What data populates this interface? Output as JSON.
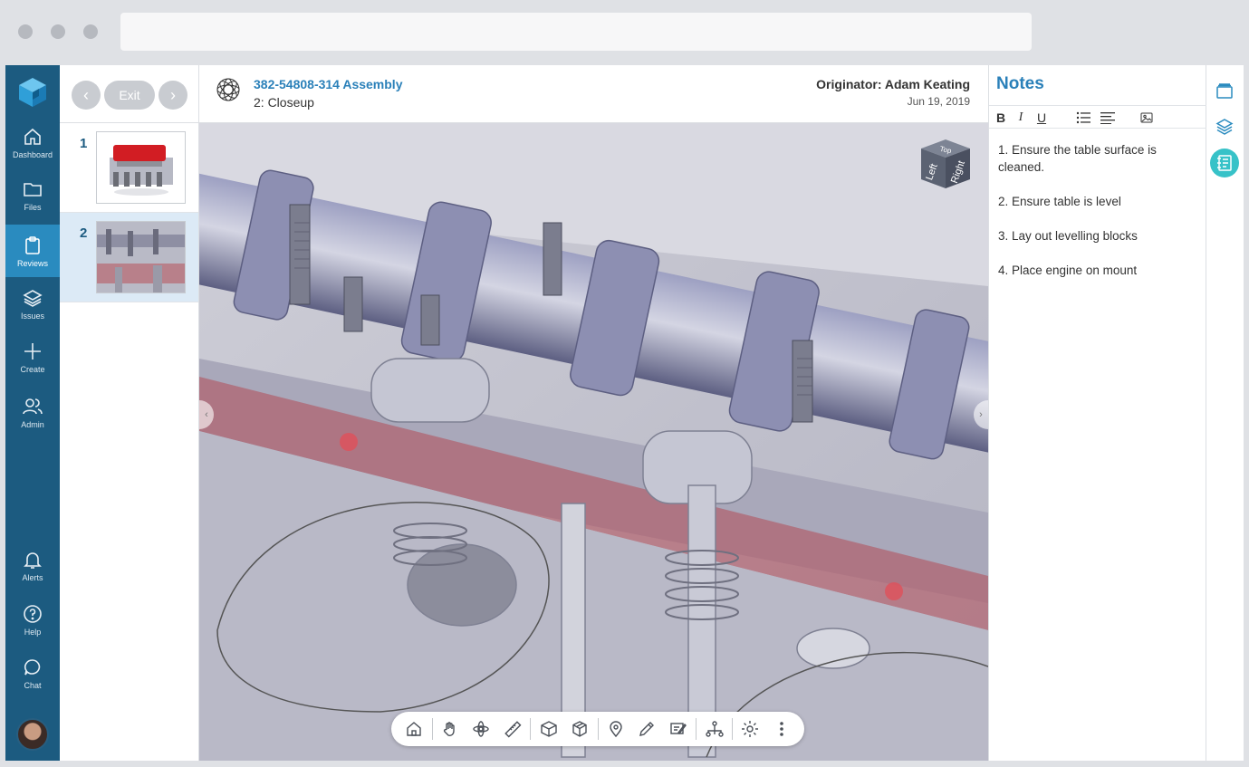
{
  "nav": {
    "items": [
      {
        "label": "Dashboard",
        "icon": "home-icon"
      },
      {
        "label": "Files",
        "icon": "folder-icon"
      },
      {
        "label": "Reviews",
        "icon": "clipboard-icon"
      },
      {
        "label": "Issues",
        "icon": "layers-icon"
      },
      {
        "label": "Create",
        "icon": "plus-icon"
      },
      {
        "label": "Admin",
        "icon": "users-icon"
      },
      {
        "label": "Alerts",
        "icon": "bell-icon"
      },
      {
        "label": "Help",
        "icon": "help-icon"
      },
      {
        "label": "Chat",
        "icon": "chat-icon"
      }
    ],
    "active": "Reviews"
  },
  "slides": {
    "exit_label": "Exit",
    "prev_icon": "chevron-left-icon",
    "next_icon": "chevron-right-icon",
    "items": [
      {
        "number": "1"
      },
      {
        "number": "2"
      }
    ],
    "selected": "2"
  },
  "header": {
    "title": "382-54808-314 Assembly",
    "subtitle": "2: Closeup",
    "originator": "Originator: Adam Keating",
    "date": "Jun 19, 2019"
  },
  "viewcube": {
    "top": "Top",
    "left": "Left",
    "right": "Right"
  },
  "toolbar": {
    "icons": [
      "home-icon",
      "pan-hand-icon",
      "orbit-icon",
      "measure-icon",
      "box-view-icon",
      "explode-view-icon",
      "pin-icon",
      "pencil-icon",
      "markup-icon",
      "tree-icon",
      "settings-icon",
      "more-icon"
    ]
  },
  "notes": {
    "title": "Notes",
    "toolbar": {
      "bold": "B",
      "italic": "I",
      "underline": "U"
    },
    "items": [
      "1. Ensure the table surface is cleaned.",
      "2. Ensure table is level",
      "3. Lay out levelling blocks",
      "4. Place engine on mount"
    ]
  },
  "rail": {
    "icons": [
      "viewer-icon",
      "layers-icon",
      "notes-icon"
    ],
    "active": "notes-icon"
  },
  "colors": {
    "nav_bg": "#1c5b80",
    "nav_active": "#2a8bbf",
    "accent": "#2a80b9",
    "rail_active": "#37c2c8"
  }
}
